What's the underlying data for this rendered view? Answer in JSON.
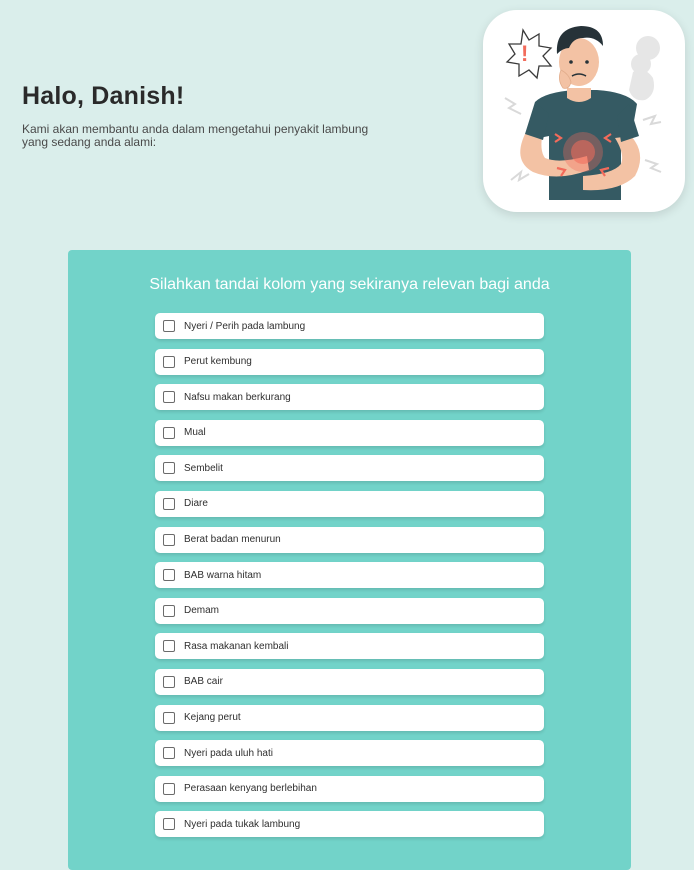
{
  "header": {
    "greeting": "Halo, Danish!",
    "description": "Kami akan membantu anda dalam mengetahui penyakit lambung yang sedang anda alami:"
  },
  "illustration": {
    "subject": "man-with-stomach-ache",
    "alert_symbol": "!"
  },
  "form": {
    "heading": "Silahkan tandai kolom yang sekiranya relevan bagi anda",
    "symptoms": [
      {
        "label": "Nyeri / Perih pada lambung",
        "checked": false
      },
      {
        "label": "Perut kembung",
        "checked": false
      },
      {
        "label": "Nafsu makan berkurang",
        "checked": false
      },
      {
        "label": "Mual",
        "checked": false
      },
      {
        "label": "Sembelit",
        "checked": false
      },
      {
        "label": "Diare",
        "checked": false
      },
      {
        "label": "Berat badan menurun",
        "checked": false
      },
      {
        "label": "BAB warna hitam",
        "checked": false
      },
      {
        "label": "Demam",
        "checked": false
      },
      {
        "label": "Rasa makanan kembali",
        "checked": false
      },
      {
        "label": "BAB cair",
        "checked": false
      },
      {
        "label": "Kejang perut",
        "checked": false
      },
      {
        "label": "Nyeri pada uluh hati",
        "checked": false
      },
      {
        "label": "Perasaan kenyang berlebihan",
        "checked": false
      },
      {
        "label": "Nyeri pada tukak lambung",
        "checked": false
      }
    ]
  },
  "colors": {
    "background": "#daeeeb",
    "panel": "#72d3c9",
    "shirt": "#355a63",
    "pain_accent": "#f26b5b"
  }
}
